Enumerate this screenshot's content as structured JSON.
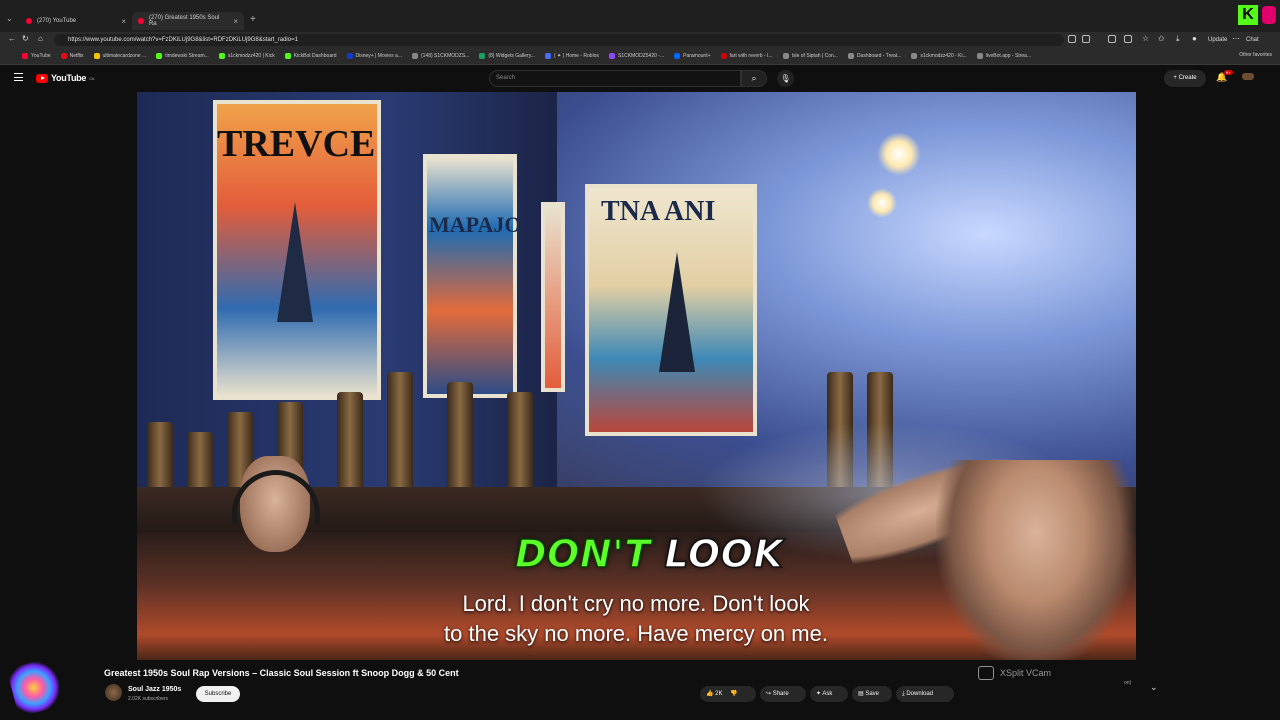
{
  "browser": {
    "tabs": [
      {
        "label": "(270) YouTube"
      },
      {
        "label": "(270) Greatest 1950s Soul Ra"
      }
    ],
    "url": "https://www.youtube.com/watch?v=FzDKiLUj9G8&list=RDFzDKiLUj9G8&start_radio=1",
    "update_label": "Update",
    "chat_label": "Chat",
    "bookmarks": [
      "YouTube",
      "Netflix",
      "ultimatecardzone ...",
      "timdewski Stream...",
      "s1ckmodzz420 | Kick",
      "KickBot Dashboard",
      "Disney+ | Movies a...",
      "(148) S1CKMODZS...",
      "(8) Widgets Gallery...",
      "( ✦ ) Home - Roblox",
      "S1CKMODZ5420 -...",
      "Paramount+",
      "fart with reverb - I...",
      "Isle of Siptah | Con...",
      "Dashboard - Treat...",
      "s1ckmodzz420 - Ki...",
      "liveBot.app - Strea..."
    ],
    "other_favorites": "Other favorites"
  },
  "youtube": {
    "logo": "YouTube",
    "logo_region": "CA",
    "search_placeholder": "Search",
    "create_label": "Create",
    "notif_count": "9+"
  },
  "video": {
    "overlay_word1": "DON'T",
    "overlay_word2": "LOOK",
    "caption_line1": "Lord. I don't cry no more. Don't look",
    "caption_line2": "to the sky no more. Have mercy on me.",
    "poster1_text": "TREVCE",
    "poster2_text": "MAPAJO",
    "poster3_text": "TNA ANI",
    "vcam_label": "XSplit VCam"
  },
  "meta": {
    "title": "Greatest 1950s Soul Rap Versions – Classic Soul Session ft Snoop Dogg & 50 Cent",
    "channel": "Soul Jazz 1950s",
    "subscribers": "2.02K subscribers",
    "subscribe_label": "Subscribe",
    "like_count": "2K",
    "share_label": "Share",
    "ask_label": "Ask",
    "save_label": "Save",
    "download_label": "Download",
    "side_text": "on)"
  }
}
